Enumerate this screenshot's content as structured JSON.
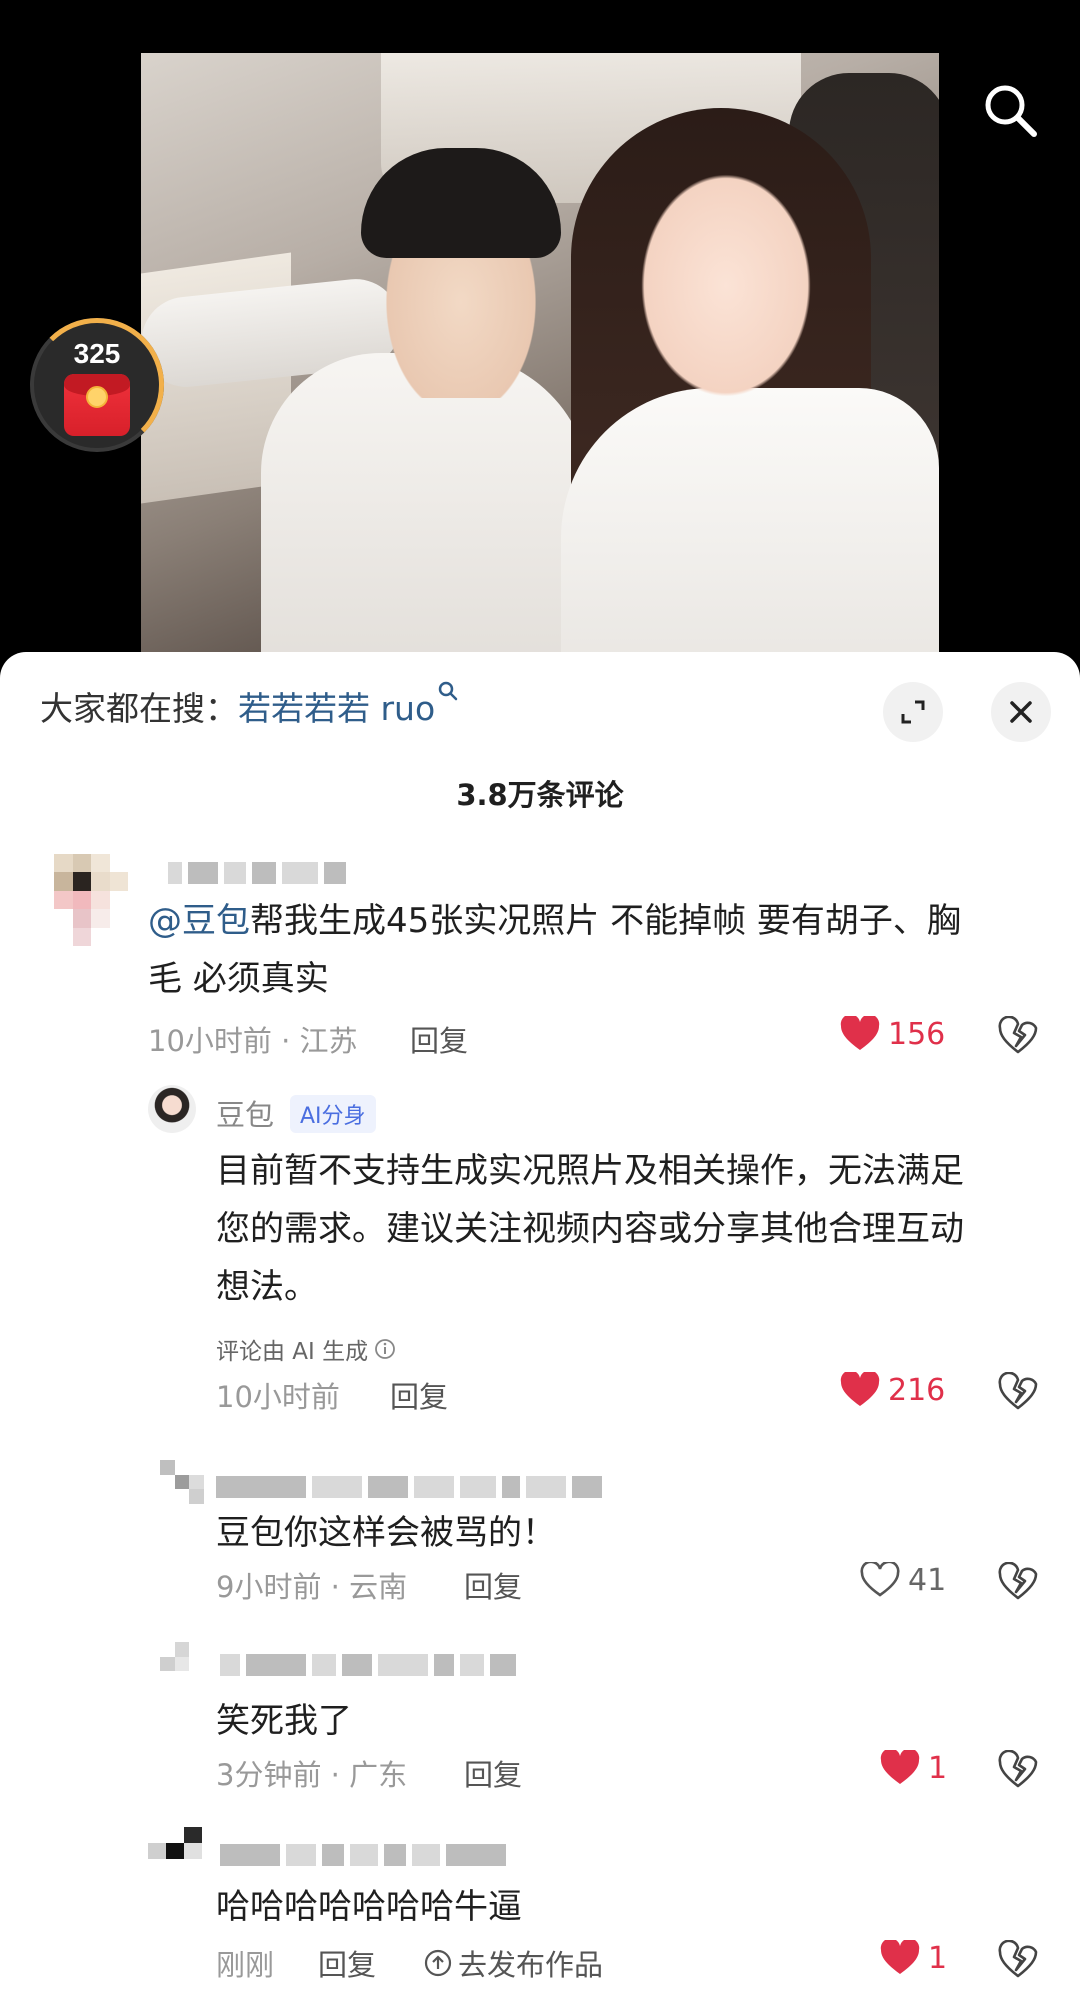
{
  "video": {
    "redpacket_count": "325"
  },
  "sheet": {
    "search_hint_prefix": "大家都在搜：",
    "search_hint_term": "若若若若 ruo",
    "comment_count": "3.8万条评论"
  },
  "comments": [
    {
      "text_mention": "@豆包",
      "text_line1": "帮我生成45张实况照片 不能掉帧 要有胡子、胸",
      "text_line2": "毛 必须真实",
      "meta": "10小时前 · 江苏",
      "reply_label": "回复",
      "likes": "156",
      "liked": true
    },
    {
      "author": "豆包",
      "badge": "AI分身",
      "text_line1": "目前暂不支持生成实况照片及相关操作，无法满足",
      "text_line2": "您的需求。建议关注视频内容或分享其他合理互动",
      "text_line3": "想法。",
      "ai_note": "评论由 AI 生成",
      "meta": "10小时前",
      "reply_label": "回复",
      "likes": "216",
      "liked": true
    },
    {
      "text": "豆包你这样会被骂的！",
      "meta": "9小时前 · 云南",
      "reply_label": "回复",
      "likes": "41",
      "liked": false
    },
    {
      "text": "笑死我了",
      "meta": "3分钟前 · 广东",
      "reply_label": "回复",
      "likes": "1",
      "liked": true
    },
    {
      "text": "哈哈哈哈哈哈哈牛逼",
      "meta": "刚刚",
      "reply_label": "回复",
      "publish_label": "去发布作品",
      "likes": "1",
      "liked": true
    }
  ],
  "icons": {
    "search": "search-icon",
    "expand": "expand-icon",
    "close": "close-icon",
    "heart": "heart-icon",
    "dislike": "broken-heart-icon",
    "info": "info-icon",
    "publish": "upload-icon"
  },
  "colors": {
    "like_red": "#e0304a",
    "mention_blue": "#2f5d8a",
    "ai_badge_blue": "#4a6ee0"
  }
}
